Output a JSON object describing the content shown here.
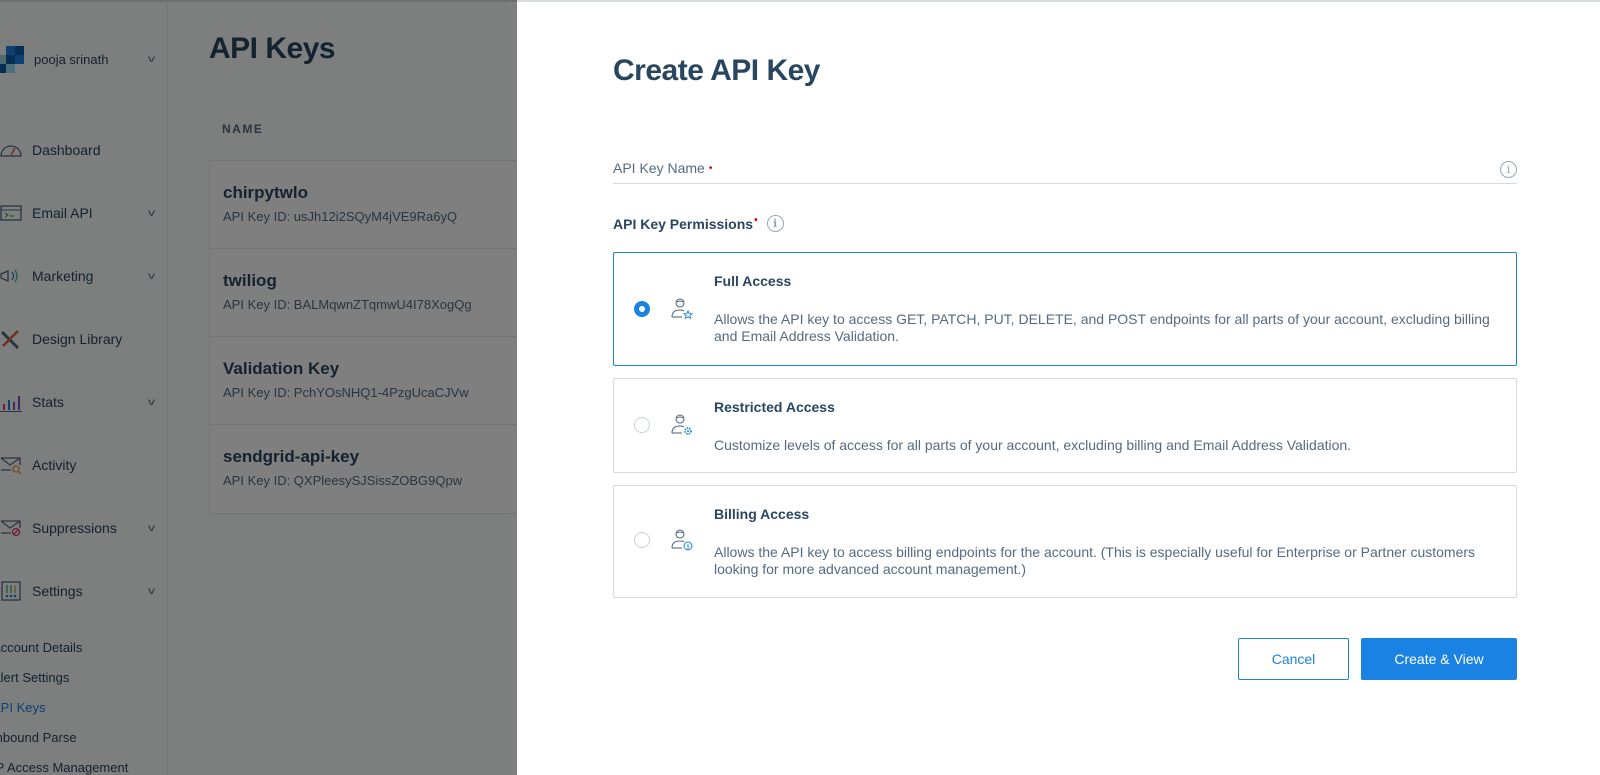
{
  "account": {
    "name": "pooja srinath"
  },
  "sidebar": {
    "items": [
      {
        "label": "Dashboard",
        "icon": "dashboard-gauge-icon",
        "expandable": false
      },
      {
        "label": "Email API",
        "icon": "terminal-window-icon",
        "expandable": true
      },
      {
        "label": "Marketing",
        "icon": "megaphone-icon",
        "expandable": true
      },
      {
        "label": "Design Library",
        "icon": "pencil-ruler-icon",
        "expandable": false
      },
      {
        "label": "Stats",
        "icon": "bar-chart-icon",
        "expandable": true
      },
      {
        "label": "Activity",
        "icon": "envelope-search-icon",
        "expandable": false
      },
      {
        "label": "Suppressions",
        "icon": "envelope-blocked-icon",
        "expandable": true
      },
      {
        "label": "Settings",
        "icon": "sliders-icon",
        "expandable": true
      }
    ],
    "settings_sub": [
      {
        "label": "Account Details",
        "active": false
      },
      {
        "label": "Alert Settings",
        "active": false
      },
      {
        "label": "API Keys",
        "active": true
      },
      {
        "label": "Inbound Parse",
        "active": false
      },
      {
        "label": "IP Access Management",
        "active": false
      }
    ]
  },
  "main": {
    "title": "API Keys",
    "column_header": "NAME",
    "keys": [
      {
        "name": "chirpytwlo",
        "id": "API Key ID: usJh12i2SQyM4jVE9Ra6yQ"
      },
      {
        "name": "twiliog",
        "id": "API Key ID: BALMqwnZTqmwU4I78XogQg"
      },
      {
        "name": "Validation Key",
        "id": "API Key ID: PchYOsNHQ1-4PzgUcaCJVw"
      },
      {
        "name": "sendgrid-api-key",
        "id": "API Key ID: QXPleesySJSissZOBG9Qpw"
      }
    ]
  },
  "drawer": {
    "title": "Create API Key",
    "name_field": {
      "label": "API Key Name",
      "value": "",
      "required_mark": "•"
    },
    "permissions_label": "API Key Permissions",
    "required_mark": "•",
    "info_glyph": "i",
    "options": [
      {
        "title": "Full Access",
        "selected": true,
        "icon": "user-star-icon",
        "description": "Allows the API key to access GET, PATCH, PUT, DELETE, and POST endpoints for all parts of your account, excluding billing and Email Address Validation."
      },
      {
        "title": "Restricted Access",
        "selected": false,
        "icon": "user-gear-icon",
        "description": "Customize levels of access for all parts of your account, excluding billing and Email Address Validation."
      },
      {
        "title": "Billing Access",
        "selected": false,
        "icon": "user-dollar-icon",
        "description": "Allows the API key to access billing endpoints for the account. (This is especially useful for Enterprise or Partner customers looking for more advanced account management.)"
      }
    ],
    "cancel_label": "Cancel",
    "create_label": "Create & View"
  },
  "colors": {
    "accent": "#1a82e2",
    "text": "#294661",
    "muted": "#546b81",
    "required": "#cc0000"
  }
}
